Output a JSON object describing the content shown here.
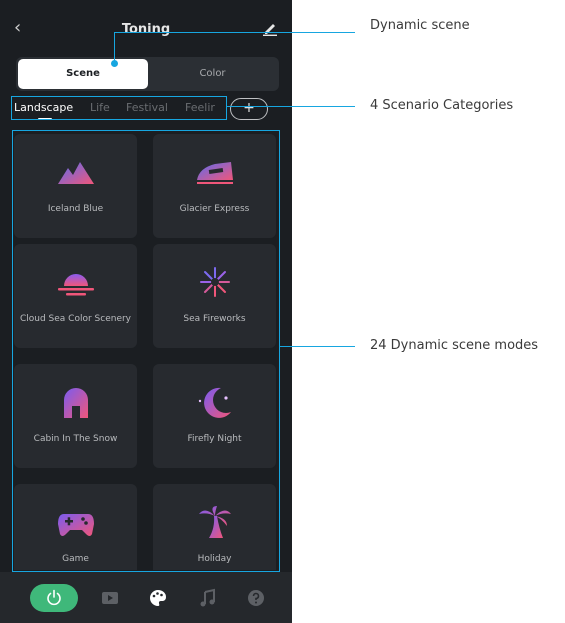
{
  "header": {
    "title": "Toning",
    "back_icon": "chevron-left-icon",
    "edit_icon": "pencil-icon"
  },
  "segment": {
    "scene": "Scene",
    "color": "Color"
  },
  "categories": [
    "Landscape",
    "Life",
    "Festival",
    "Feelir"
  ],
  "add_label": "+",
  "scenes": [
    {
      "label": "Iceland Blue",
      "icon": "mountains-icon"
    },
    {
      "label": "Glacier Express",
      "icon": "train-icon"
    },
    {
      "label": "Cloud Sea Color Scenery",
      "icon": "sunset-icon"
    },
    {
      "label": "Sea Fireworks",
      "icon": "fireworks-icon"
    },
    {
      "label": "Cabin In The Snow",
      "icon": "cabin-icon"
    },
    {
      "label": "Firefly Night",
      "icon": "moon-icon"
    },
    {
      "label": "Game",
      "icon": "gamepad-icon"
    },
    {
      "label": "Holiday",
      "icon": "palm-tree-icon"
    }
  ],
  "bottom_nav": [
    "power-icon",
    "video-icon",
    "palette-icon",
    "music-icon",
    "help-icon"
  ],
  "annotations": {
    "dynamic_scene": "Dynamic scene",
    "categories": "4 Scenario Categories",
    "modes": "24 Dynamic scene modes"
  },
  "colors": {
    "accent": "#17a6e0",
    "power": "#3fb87a",
    "background": "#1b1e22",
    "card": "#272a2f"
  }
}
